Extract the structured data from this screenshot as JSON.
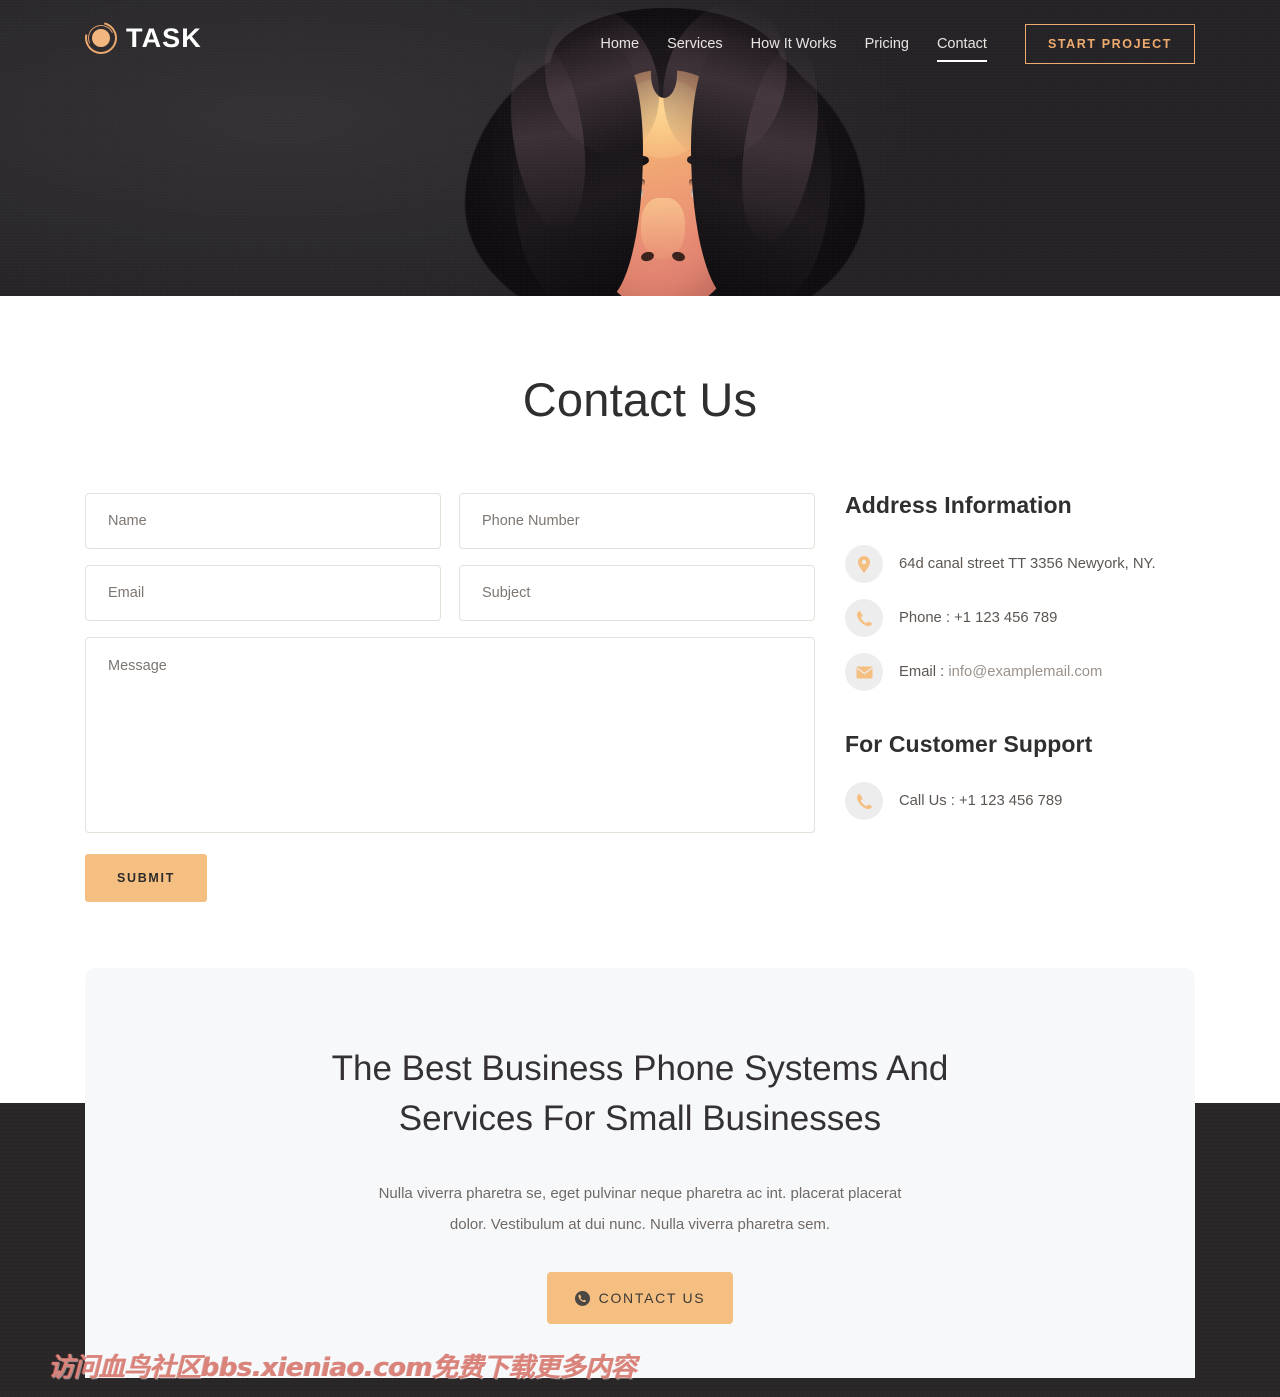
{
  "header": {
    "logo_text": "TASK",
    "nav_items": [
      {
        "label": "Home",
        "active": false
      },
      {
        "label": "Services",
        "active": false
      },
      {
        "label": "How It Works",
        "active": false
      },
      {
        "label": "Pricing",
        "active": false
      },
      {
        "label": "Contact",
        "active": true
      }
    ],
    "cta_label": "START PROJECT",
    "accent_color": "#eeab6e",
    "background_color": "#2a282b"
  },
  "contact": {
    "title": "Contact Us",
    "form": {
      "name_placeholder": "Name",
      "phone_placeholder": "Phone Number",
      "email_placeholder": "Email",
      "subject_placeholder": "Subject",
      "message_placeholder": "Message",
      "submit_label": "SUBMIT",
      "submit_color": "#f6bf82"
    },
    "address": {
      "heading": "Address Information",
      "items": [
        {
          "icon": "location-pin-icon",
          "text": "64d canal street TT 3356 Newyork, NY."
        },
        {
          "icon": "phone-icon",
          "label": "Phone : ",
          "value": "+1 123 456 789"
        },
        {
          "icon": "envelope-icon",
          "label": "Email : ",
          "value": "info@examplemail.com"
        }
      ]
    },
    "support": {
      "heading": "For Customer Support",
      "items": [
        {
          "icon": "phone-icon",
          "label": "Call Us : ",
          "value": "+1 123 456 789"
        }
      ]
    }
  },
  "cta": {
    "title_line1": "The Best Business Phone Systems And",
    "title_line2": "Services For Small Businesses",
    "subtitle_line1": "Nulla viverra pharetra se, eget pulvinar neque pharetra ac int. placerat placerat",
    "subtitle_line2": "dolor. Vestibulum at dui nunc. Nulla viverra pharetra sem.",
    "button_label": "CONTACT US",
    "button_color": "#f6bf82",
    "panel_color": "#f7f8fa"
  },
  "watermark": {
    "text": "访问血鸟社区bbs.xieniao.com免费下载更多内容"
  }
}
